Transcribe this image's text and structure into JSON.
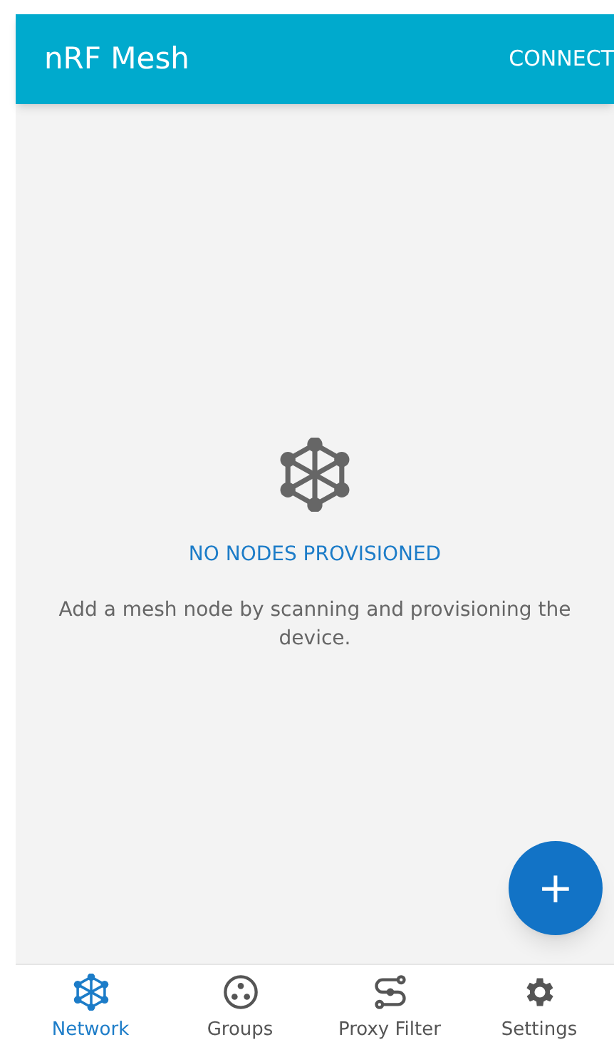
{
  "app_bar": {
    "title": "nRF Mesh",
    "action": "CONNECT"
  },
  "empty_state": {
    "heading": "NO NODES PROVISIONED",
    "message": "Add a mesh node by scanning and provisioning the device."
  },
  "fab": {
    "label": "+"
  },
  "bottom_nav": [
    {
      "kind": "network",
      "label": "Network",
      "selected": true
    },
    {
      "kind": "groups",
      "label": "Groups",
      "selected": false
    },
    {
      "kind": "proxy",
      "label": "Proxy Filter",
      "selected": false
    },
    {
      "kind": "settings",
      "label": "Settings",
      "selected": false
    }
  ]
}
